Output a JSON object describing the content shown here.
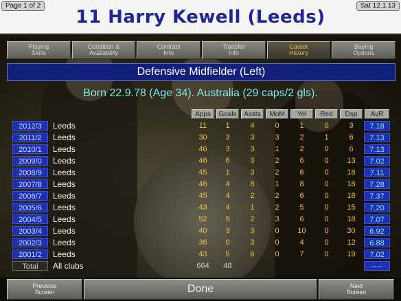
{
  "header": {
    "page_indicator": "Page 1 of 2",
    "date": "Sat 12.1.13",
    "title": "11  Harry Kewell (Leeds)"
  },
  "tabs": [
    {
      "label": "Playing\nSkills",
      "active": false
    },
    {
      "label": "Condition &\nAvailability",
      "active": false
    },
    {
      "label": "Contract\nInfo",
      "active": false
    },
    {
      "label": "Transfer\nInfo",
      "active": false
    },
    {
      "label": "Career\nHistory",
      "active": true
    },
    {
      "label": "Buying\nOptions",
      "active": false
    }
  ],
  "position": "Defensive Midfielder (Left)",
  "bio": "Born 22.9.78 (Age 34). Australia (29 caps/2 gls).",
  "table": {
    "columns": [
      "Apps",
      "Goals",
      "Assts",
      "MoM",
      "Yel",
      "Red",
      "Dsp",
      "AvR"
    ],
    "rows": [
      {
        "season": "2012/3",
        "club": "Leeds",
        "apps": "11",
        "goals": "1",
        "assts": "4",
        "mom": "0",
        "yel": "1",
        "red": "0",
        "dsp": "3",
        "avr": "7.18"
      },
      {
        "season": "2011/2",
        "club": "Leeds",
        "apps": "30",
        "goals": "3",
        "assts": "3",
        "mom": "3",
        "yel": "2",
        "red": "1",
        "dsp": "6",
        "avr": "7.13"
      },
      {
        "season": "2010/1",
        "club": "Leeds",
        "apps": "46",
        "goals": "3",
        "assts": "3",
        "mom": "1",
        "yel": "2",
        "red": "0",
        "dsp": "6",
        "avr": "7.13"
      },
      {
        "season": "2009/0",
        "club": "Leeds",
        "apps": "46",
        "goals": "6",
        "assts": "3",
        "mom": "2",
        "yel": "6",
        "red": "0",
        "dsp": "13",
        "avr": "7.02"
      },
      {
        "season": "2008/9",
        "club": "Leeds",
        "apps": "45",
        "goals": "1",
        "assts": "3",
        "mom": "2",
        "yel": "6",
        "red": "0",
        "dsp": "18",
        "avr": "7.11"
      },
      {
        "season": "2007/8",
        "club": "Leeds",
        "apps": "46",
        "goals": "4",
        "assts": "8",
        "mom": "1",
        "yel": "8",
        "red": "0",
        "dsp": "18",
        "avr": "7.28"
      },
      {
        "season": "2006/7",
        "club": "Leeds",
        "apps": "45",
        "goals": "4",
        "assts": "2",
        "mom": "2",
        "yel": "6",
        "red": "0",
        "dsp": "18",
        "avr": "7.37"
      },
      {
        "season": "2005/6",
        "club": "Leeds",
        "apps": "43",
        "goals": "4",
        "assts": "1",
        "mom": "2",
        "yel": "5",
        "red": "0",
        "dsp": "15",
        "avr": "7.20"
      },
      {
        "season": "2004/5",
        "club": "Leeds",
        "apps": "52",
        "goals": "5",
        "assts": "2",
        "mom": "3",
        "yel": "6",
        "red": "0",
        "dsp": "18",
        "avr": "7.07"
      },
      {
        "season": "2003/4",
        "club": "Leeds",
        "apps": "40",
        "goals": "3",
        "assts": "3",
        "mom": "0",
        "yel": "10",
        "red": "0",
        "dsp": "30",
        "avr": "6.92"
      },
      {
        "season": "2002/3",
        "club": "Leeds",
        "apps": "36",
        "goals": "0",
        "assts": "3",
        "mom": "0",
        "yel": "4",
        "red": "0",
        "dsp": "12",
        "avr": "6.88"
      },
      {
        "season": "2001/2",
        "club": "Leeds",
        "apps": "43",
        "goals": "5",
        "assts": "6",
        "mom": "0",
        "yel": "7",
        "red": "0",
        "dsp": "19",
        "avr": "7.02"
      }
    ],
    "total": {
      "season": "Total",
      "club": "All clubs",
      "apps": "664",
      "goals": "48",
      "avr": "----"
    }
  },
  "buttons": {
    "previous": "Previous\nScreen",
    "done": "Done",
    "next": "Next\nScreen"
  },
  "colors": {
    "title": "#1f2796",
    "bio": "#7de6e8",
    "stat_values": "#f0c040",
    "season_chip": "#1b31b0",
    "active_tab": "#e8b94c"
  }
}
